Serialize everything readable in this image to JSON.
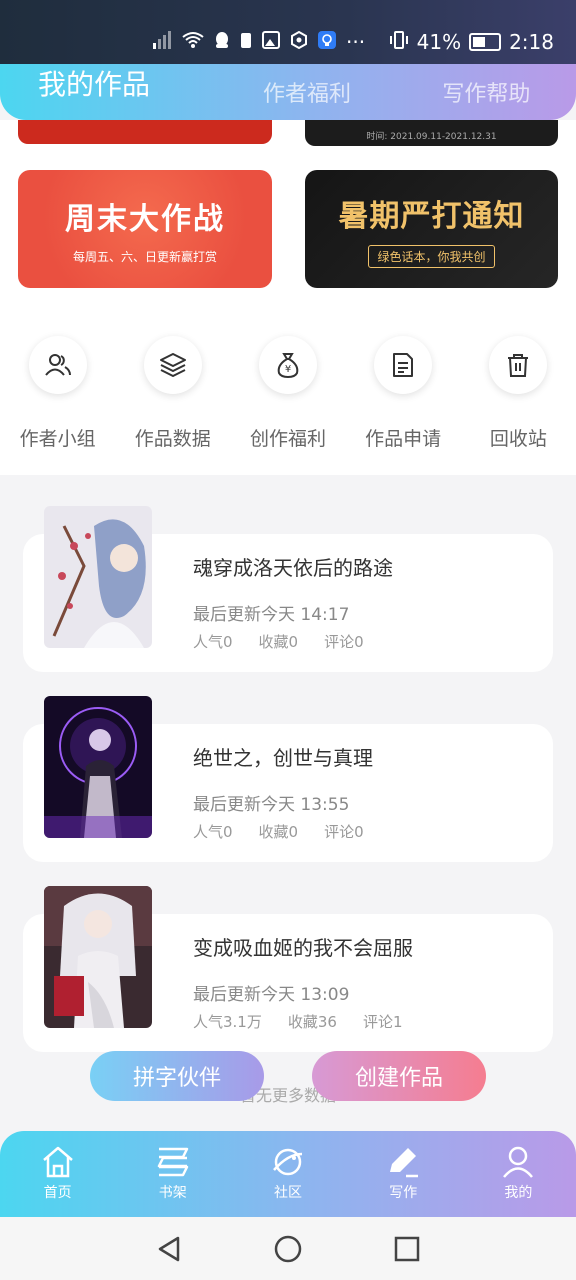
{
  "status_bar": {
    "battery": "41%",
    "time": "2:18",
    "more": "···"
  },
  "header": {
    "tabs": [
      "我的作品",
      "作者福利",
      "写作帮助"
    ]
  },
  "banners": {
    "dark_top_text": "时间: 2021.09.11-2021.12.31",
    "weekend": {
      "title": "周末大作战",
      "subtitle": "每周五、六、日更新赢打赏"
    },
    "summer": {
      "title": "暑期严打通知",
      "subtitle": "绿色话本，你我共创"
    }
  },
  "quick_actions": [
    {
      "label": "作者小组",
      "icon": "users-icon"
    },
    {
      "label": "作品数据",
      "icon": "layers-icon"
    },
    {
      "label": "创作福利",
      "icon": "money-bag-icon"
    },
    {
      "label": "作品申请",
      "icon": "document-icon"
    },
    {
      "label": "回收站",
      "icon": "trash-icon"
    }
  ],
  "works": [
    {
      "title": "魂穿成洛天依后的路途",
      "updated": "最后更新今天 14:17",
      "popularity": "人气0",
      "favorites": "收藏0",
      "comments": "评论0"
    },
    {
      "title": "绝世之，创世与真理",
      "updated": "最后更新今天 13:55",
      "popularity": "人气0",
      "favorites": "收藏0",
      "comments": "评论0"
    },
    {
      "title": "变成吸血姬的我不会屈服",
      "updated": "最后更新今天 13:09",
      "popularity": "人气3.1万",
      "favorites": "收藏36",
      "comments": "评论1"
    }
  ],
  "footer_note": "暂无更多数据",
  "fab": {
    "left": "拼字伙伴",
    "right": "创建作品"
  },
  "bottom_nav": [
    "首页",
    "书架",
    "社区",
    "写作",
    "我的"
  ],
  "colors": {
    "gradient_start": "#4cd6f0",
    "gradient_end": "#b99ae8",
    "banner_red": "#ea5040",
    "banner_gold": "#f1c26a"
  }
}
